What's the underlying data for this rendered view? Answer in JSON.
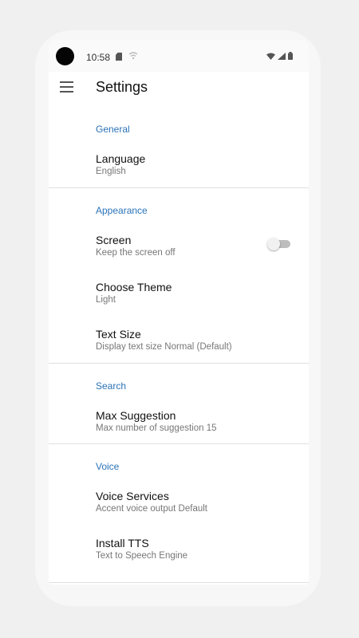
{
  "status_bar": {
    "time": "10:58"
  },
  "app_bar": {
    "title": "Settings"
  },
  "sections": [
    {
      "header": "General",
      "items": [
        {
          "title": "Language",
          "subtitle": "English"
        }
      ]
    },
    {
      "header": "Appearance",
      "items": [
        {
          "title": "Screen",
          "subtitle": "Keep the screen off",
          "toggle": false
        },
        {
          "title": "Choose Theme",
          "subtitle": "Light"
        },
        {
          "title": "Text Size",
          "subtitle": "Display text size Normal (Default)"
        }
      ]
    },
    {
      "header": "Search",
      "items": [
        {
          "title": "Max Suggestion",
          "subtitle": "Max number of suggestion 15"
        }
      ]
    },
    {
      "header": "Voice",
      "items": [
        {
          "title": "Voice Services",
          "subtitle": "Accent voice output Default"
        },
        {
          "title": "Install TTS",
          "subtitle": "Text to Speech Engine"
        }
      ]
    }
  ],
  "colors": {
    "accent": "#2b73b8",
    "background": "#ffffff",
    "divider": "#e0e0e0"
  }
}
